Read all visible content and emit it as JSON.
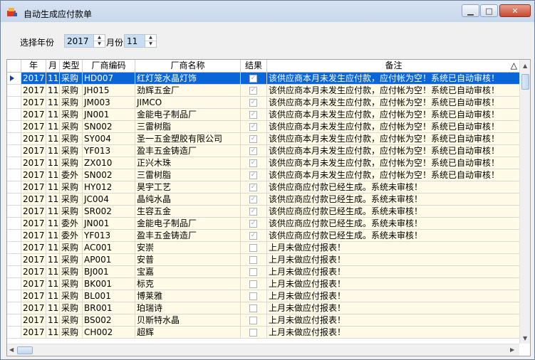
{
  "window": {
    "title": "自动生成应付款单"
  },
  "filters": {
    "year_label": "选择年份",
    "year_value": "2017",
    "month_label": "月份",
    "month_value": "11"
  },
  "grid": {
    "columns": [
      "年",
      "月",
      "类型",
      "厂商编码",
      "厂商名称",
      "结果",
      "备注"
    ],
    "sort_indicator": "△",
    "rows": [
      {
        "year": "2017",
        "month": "11",
        "type": "采购",
        "code": "HD007",
        "name": "红灯笼水晶灯饰",
        "result": true,
        "note": "该供应商本月未发生应付款，应付帐为空！系统已自动审核！"
      },
      {
        "year": "2017",
        "month": "11",
        "type": "采购",
        "code": "JH015",
        "name": "劲辉五金厂",
        "result": true,
        "note": "该供应商本月未发生应付款，应付帐为空！系统已自动审核！"
      },
      {
        "year": "2017",
        "month": "11",
        "type": "采购",
        "code": "JM003",
        "name": "JIMCO",
        "result": true,
        "note": "该供应商本月未发生应付款，应付帐为空！系统已自动审核！"
      },
      {
        "year": "2017",
        "month": "11",
        "type": "采购",
        "code": "JN001",
        "name": "金能电子制品厂",
        "result": true,
        "note": "该供应商本月未发生应付款，应付帐为空！系统已自动审核！"
      },
      {
        "year": "2017",
        "month": "11",
        "type": "采购",
        "code": "SN002",
        "name": "三雷树脂",
        "result": true,
        "note": "该供应商本月未发生应付款，应付帐为空！系统已自动审核！"
      },
      {
        "year": "2017",
        "month": "11",
        "type": "采购",
        "code": "SY004",
        "name": "圣一五金塑胶有限公司",
        "result": true,
        "note": "该供应商本月未发生应付款，应付帐为空！系统已自动审核！"
      },
      {
        "year": "2017",
        "month": "11",
        "type": "采购",
        "code": "YF013",
        "name": "盈丰五金铸造厂",
        "result": true,
        "note": "该供应商本月未发生应付款，应付帐为空！系统已自动审核！"
      },
      {
        "year": "2017",
        "month": "11",
        "type": "采购",
        "code": "ZX010",
        "name": "正兴木珠",
        "result": true,
        "note": "该供应商本月未发生应付款，应付帐为空！系统已自动审核！"
      },
      {
        "year": "2017",
        "month": "11",
        "type": "委外",
        "code": "SN002",
        "name": "三雷树脂",
        "result": true,
        "note": "该供应商本月未发生应付款，应付帐为空！系统已自动审核！"
      },
      {
        "year": "2017",
        "month": "11",
        "type": "采购",
        "code": "HY012",
        "name": "昊宇工艺",
        "result": true,
        "note": "该供应商应付款已经生成。系统未审核！"
      },
      {
        "year": "2017",
        "month": "11",
        "type": "采购",
        "code": "JC004",
        "name": "晶纯水晶",
        "result": true,
        "note": "该供应商应付款已经生成。系统未审核！"
      },
      {
        "year": "2017",
        "month": "11",
        "type": "采购",
        "code": "SR002",
        "name": "生容五金",
        "result": true,
        "note": "该供应商应付款已经生成。系统未审核！"
      },
      {
        "year": "2017",
        "month": "11",
        "type": "委外",
        "code": "JN001",
        "name": "金能电子制品厂",
        "result": true,
        "note": "该供应商应付款已经生成。系统未审核！"
      },
      {
        "year": "2017",
        "month": "11",
        "type": "委外",
        "code": "YF013",
        "name": "盈丰五金铸造厂",
        "result": true,
        "note": "该供应商应付款已经生成。系统未审核！"
      },
      {
        "year": "2017",
        "month": "11",
        "type": "采购",
        "code": "AC001",
        "name": "安崇",
        "result": false,
        "note": "上月未做应付报表！"
      },
      {
        "year": "2017",
        "month": "11",
        "type": "采购",
        "code": "AP001",
        "name": "安普",
        "result": false,
        "note": "上月未做应付报表！"
      },
      {
        "year": "2017",
        "month": "11",
        "type": "采购",
        "code": "BJ001",
        "name": "宝嘉",
        "result": false,
        "note": "上月未做应付报表！"
      },
      {
        "year": "2017",
        "month": "11",
        "type": "采购",
        "code": "BK001",
        "name": "标克",
        "result": false,
        "note": "上月未做应付报表！"
      },
      {
        "year": "2017",
        "month": "11",
        "type": "采购",
        "code": "BL001",
        "name": "博莱雅",
        "result": false,
        "note": "上月未做应付报表！"
      },
      {
        "year": "2017",
        "month": "11",
        "type": "采购",
        "code": "BR001",
        "name": "珀瑞诗",
        "result": false,
        "note": "上月未做应付报表！"
      },
      {
        "year": "2017",
        "month": "11",
        "type": "采购",
        "code": "BS002",
        "name": "贝斯特水晶",
        "result": false,
        "note": "上月未做应付报表！"
      },
      {
        "year": "2017",
        "month": "11",
        "type": "采购",
        "code": "CH002",
        "name": "超辉",
        "result": false,
        "note": "上月未做应付报表！"
      }
    ]
  }
}
